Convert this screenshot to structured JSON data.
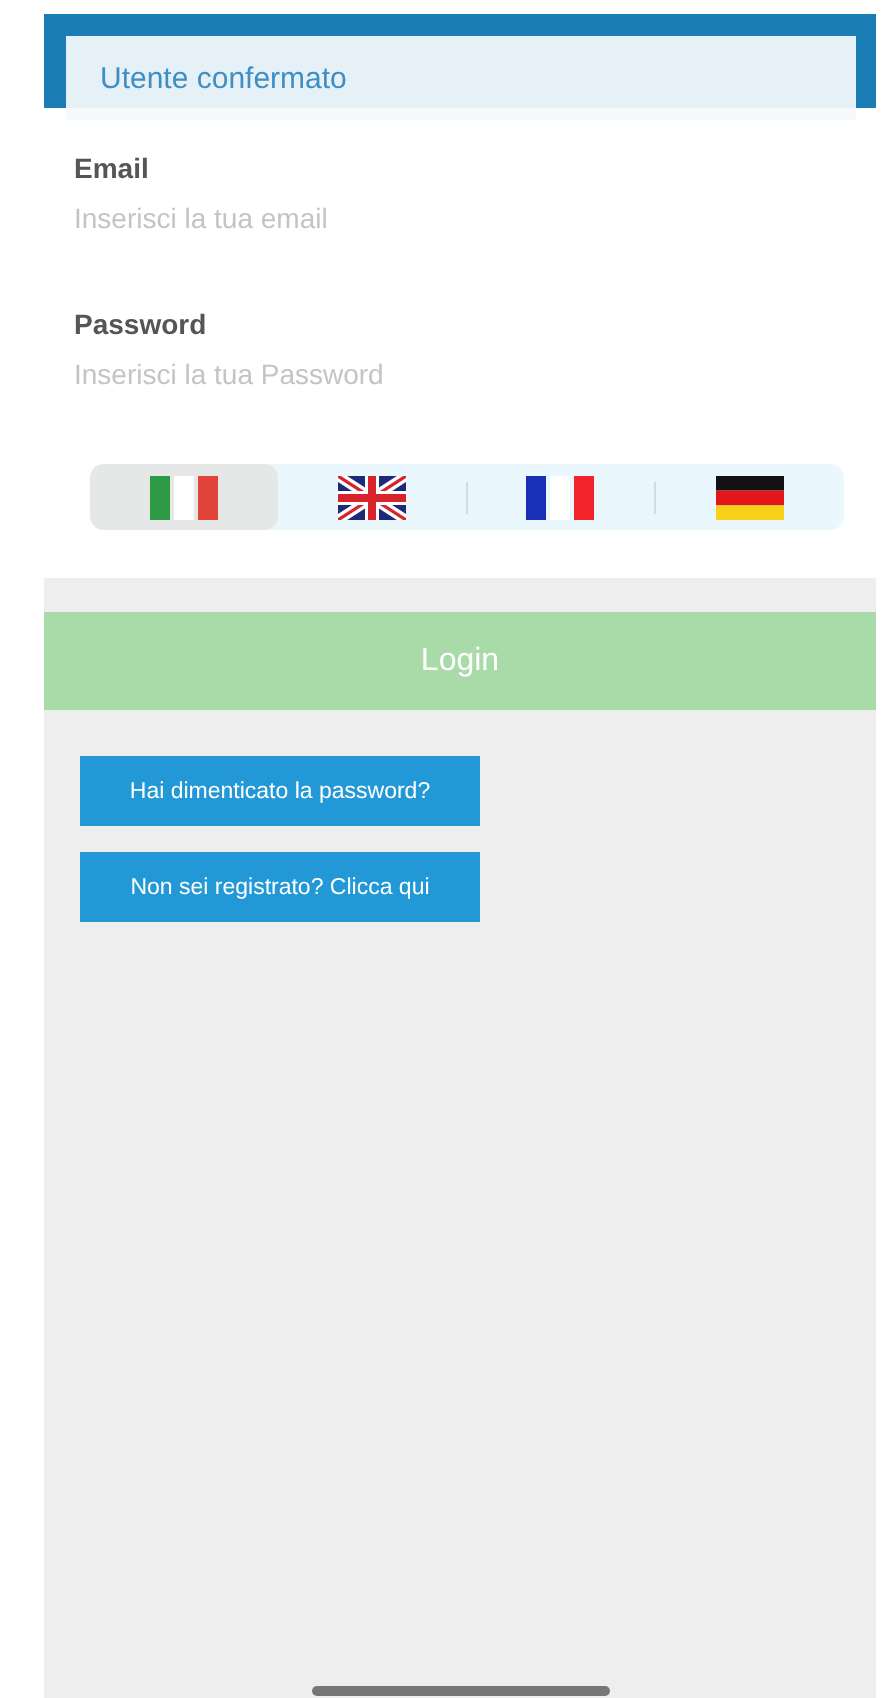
{
  "toast": {
    "message": "Utente confermato"
  },
  "fields": [
    {
      "label": "Email",
      "placeholder": "Inserisci la tua email"
    },
    {
      "label": "Password",
      "placeholder": "Inserisci la tua Password"
    }
  ],
  "languages": [
    {
      "kind": "it",
      "selected": true
    },
    {
      "kind": "gb",
      "selected": false
    },
    {
      "kind": "fr",
      "selected": false
    },
    {
      "kind": "de",
      "selected": false
    }
  ],
  "login_button": {
    "label": "Login",
    "disabled": true
  },
  "links": [
    "Hai dimenticato la password?",
    "Non sei registrato? Clicca qui"
  ]
}
